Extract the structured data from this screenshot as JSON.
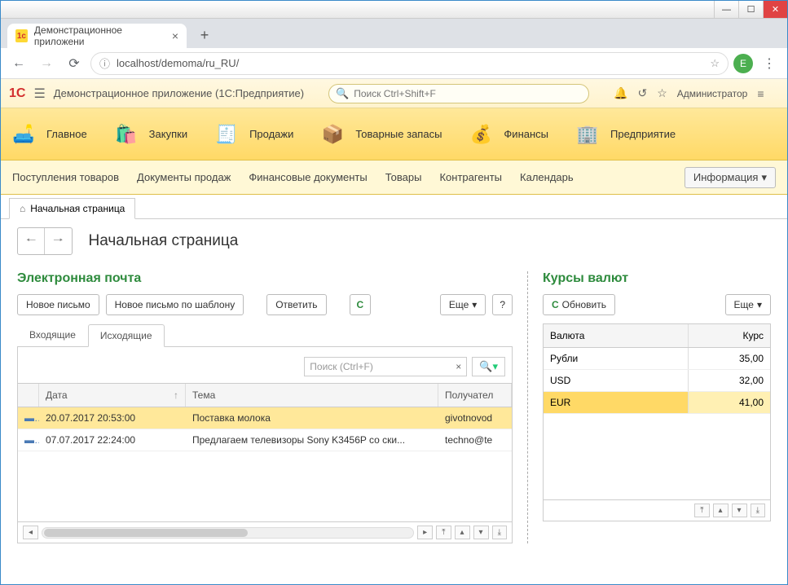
{
  "window": {
    "tab_title": "Демонстрационное приложени",
    "url": "localhost/demoma/ru_RU/",
    "avatar": "E"
  },
  "app": {
    "title": "Демонстрационное приложение  (1С:Предприятие)",
    "search_placeholder": "Поиск Ctrl+Shift+F",
    "user": "Администратор"
  },
  "sections": [
    {
      "label": "Главное",
      "icon": "🛋️"
    },
    {
      "label": "Закупки",
      "icon": "🛍️"
    },
    {
      "label": "Продажи",
      "icon": "🧾"
    },
    {
      "label": "Товарные запасы",
      "icon": "📦"
    },
    {
      "label": "Финансы",
      "icon": "💰"
    },
    {
      "label": "Предприятие",
      "icon": "🏢"
    }
  ],
  "commands": [
    "Поступления товаров",
    "Документы продаж",
    "Финансовые документы",
    "Товары",
    "Контрагенты",
    "Календарь"
  ],
  "info_button": "Информация",
  "nav_tab": "Начальная страница",
  "page_title": "Начальная страница",
  "email": {
    "title": "Электронная почта",
    "buttons": {
      "new": "Новое письмо",
      "new_tpl": "Новое письмо по шаблону",
      "reply": "Ответить",
      "more": "Еще",
      "help": "?"
    },
    "tabs": {
      "inbox": "Входящие",
      "outbox": "Исходящие"
    },
    "search_placeholder": "Поиск (Ctrl+F)",
    "columns": {
      "date": "Дата",
      "subject": "Тема",
      "recipient": "Получател"
    },
    "rows": [
      {
        "date": "20.07.2017 20:53:00",
        "subject": "Поставка молока",
        "recipient": "givotnovod"
      },
      {
        "date": "07.07.2017 22:24:00",
        "subject": "Предлагаем телевизоры Sony K3456P со ски...",
        "recipient": "techno@te"
      }
    ]
  },
  "rates": {
    "title": "Курсы валют",
    "buttons": {
      "refresh": "Обновить",
      "more": "Еще"
    },
    "columns": {
      "currency": "Валюта",
      "rate": "Курс"
    },
    "rows": [
      {
        "currency": "Рубли",
        "rate": "35,00"
      },
      {
        "currency": "USD",
        "rate": "32,00"
      },
      {
        "currency": "EUR",
        "rate": "41,00"
      }
    ]
  }
}
